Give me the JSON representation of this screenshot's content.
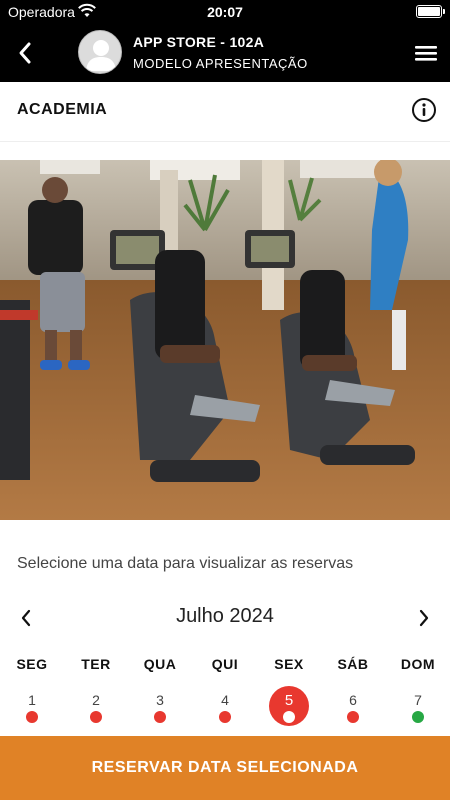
{
  "status_bar": {
    "carrier": "Operadora",
    "time": "20:07"
  },
  "header": {
    "title": "APP STORE - 102A",
    "subtitle": "MODELO APRESENTAÇÃO"
  },
  "section": {
    "title": "ACADEMIA"
  },
  "calendar": {
    "prompt": "Selecione uma data para visualizar as reservas",
    "month": "Julho 2024",
    "weekdays": [
      "SEG",
      "TER",
      "QUA",
      "QUI",
      "SEX",
      "SÁB",
      "DOM"
    ],
    "days": [
      {
        "label": "1",
        "status": "unavailable"
      },
      {
        "label": "2",
        "status": "unavailable"
      },
      {
        "label": "3",
        "status": "unavailable"
      },
      {
        "label": "4",
        "status": "unavailable"
      },
      {
        "label": "5",
        "status": "selected"
      },
      {
        "label": "6",
        "status": "unavailable"
      },
      {
        "label": "7",
        "status": "available"
      }
    ]
  },
  "actions": {
    "reserve_label": "RESERVAR DATA SELECIONADA"
  },
  "colors": {
    "accent": "#e08226",
    "selected": "#e8382f",
    "unavailable_dot": "#e8382f",
    "available_dot": "#27a844",
    "header_bg": "#000000"
  }
}
